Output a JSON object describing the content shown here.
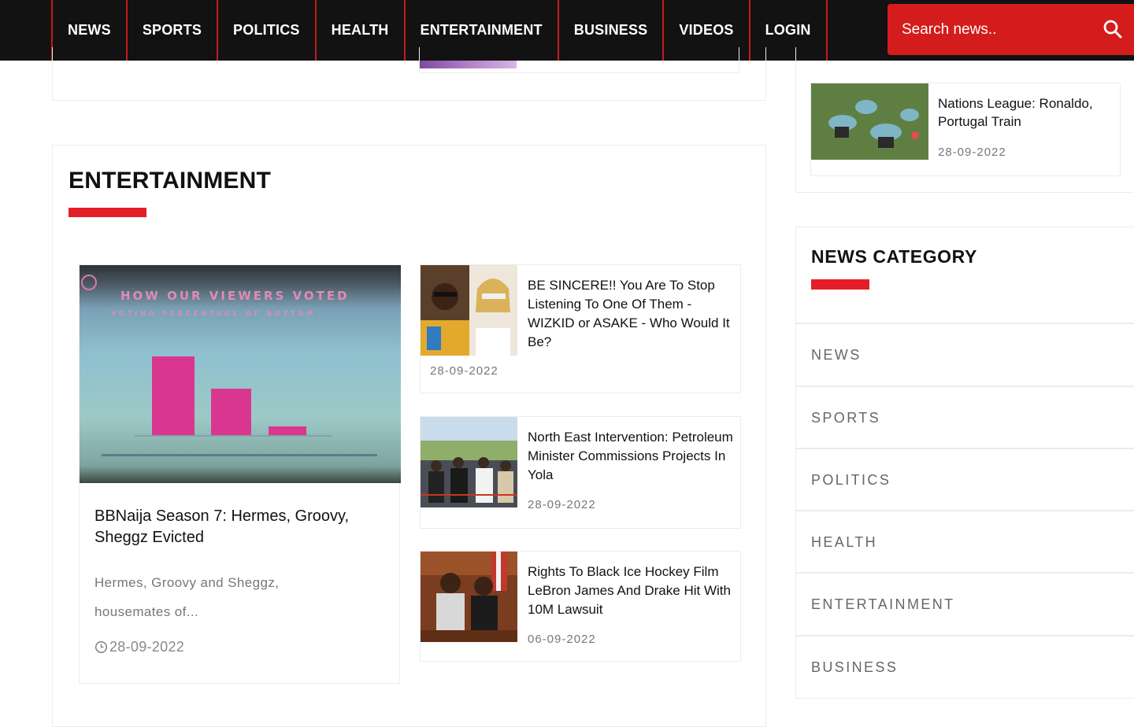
{
  "nav": {
    "items": [
      "NEWS",
      "SPORTS",
      "POLITICS",
      "HEALTH",
      "ENTERTAINMENT",
      "BUSINESS",
      "VIDEOS",
      "LOGIN"
    ],
    "search_placeholder": "Search news.."
  },
  "entertainment": {
    "title": "ENTERTAINMENT",
    "featured": {
      "image_caption": "HOW OUR VIEWERS VOTED",
      "image_subcaption": "VOTING PERCENTAGE OF BOTTOM",
      "title": "BBNaija Season 7: Hermes, Groovy, Sheggz Evicted",
      "excerpt": "Hermes, Groovy and Sheggz, housemates of...",
      "date": "28-09-2022"
    },
    "side": [
      {
        "title": "BE SINCERE!! You Are To Stop Listening To One Of Them - WIZKID or ASAKE - Who Would It Be?",
        "date": "28-09-2022"
      },
      {
        "title": "North East Intervention: Petroleum Minister Commissions Projects In Yola",
        "date": "28-09-2022"
      },
      {
        "title": "Rights To Black Ice Hockey Film LeBron James And Drake Hit With 10M Lawsuit",
        "date": "06-09-2022"
      }
    ]
  },
  "sidebar": {
    "recent": {
      "title": "Nations League: Ronaldo, Portugal Train",
      "date": "28-09-2022"
    },
    "category_title": "NEWS CATEGORY",
    "categories": [
      "NEWS",
      "SPORTS",
      "POLITICS",
      "HEALTH",
      "ENTERTAINMENT",
      "BUSINESS"
    ]
  },
  "colors": {
    "accent": "#e41e26",
    "nav_bg": "#121212",
    "search_bg": "#d41c1c"
  }
}
